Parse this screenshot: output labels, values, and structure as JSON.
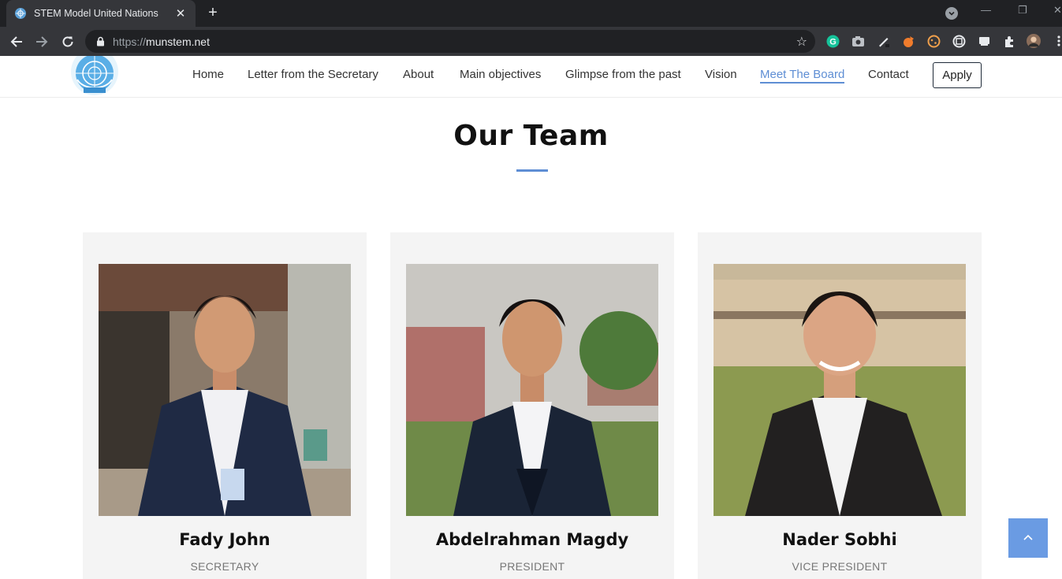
{
  "browser": {
    "tab_title": "STEM Model United Nations",
    "url_scheme": "https://",
    "url_host": "munstem.net",
    "new_tab_label": "+",
    "close_tab_label": "✕",
    "bookmark_label": "☆"
  },
  "site": {
    "nav": {
      "home": "Home",
      "letter": "Letter from the Secretary",
      "about": "About",
      "objectives": "Main objectives",
      "glimpse": "Glimpse from the past",
      "vision": "Vision",
      "board": "Meet The Board",
      "contact": "Contact",
      "apply": "Apply"
    },
    "active_nav": "Meet The Board"
  },
  "team": {
    "title": "Our Team",
    "accent_color": "#5e8ed4",
    "members": [
      {
        "name": "Fady John",
        "role": "SECRETARY"
      },
      {
        "name": "Abdelrahman Magdy",
        "role": "PRESIDENT"
      },
      {
        "name": "Nader Sobhi",
        "role": "VICE PRESIDENT"
      }
    ]
  },
  "back_to_top": {
    "icon": "chevron-up-icon",
    "color": "#6a9be3"
  }
}
